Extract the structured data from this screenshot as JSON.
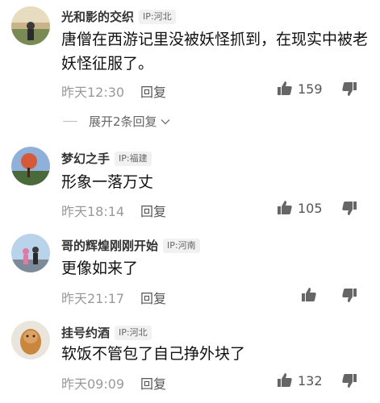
{
  "comments": [
    {
      "username": "光和影的交织",
      "ip": "IP:河北",
      "text": "唐僧在西游记里没被妖怪抓到，在现实中被老妖怪征服了。",
      "time": "昨天12:30",
      "reply_label": "回复",
      "likes": "159"
    },
    {
      "username": "梦幻之手",
      "ip": "IP:福建",
      "text": "形象一落万丈",
      "time": "昨天18:14",
      "reply_label": "回复",
      "likes": "105"
    },
    {
      "username": "哥的辉煌刚刚开始",
      "ip": "IP:河南",
      "text": "更像如来了",
      "time": "昨天21:17",
      "reply_label": "回复",
      "likes": ""
    },
    {
      "username": "挂号约酒",
      "ip": "IP:河北",
      "text": "软饭不管包了自己挣外块了",
      "time": "昨天09:09",
      "reply_label": "回复",
      "likes": "132"
    }
  ],
  "expand_replies": "展开2条回复",
  "icons": {
    "like": "thumbs-up-icon",
    "dislike": "thumbs-down-icon",
    "expand": "chevron-down-icon"
  },
  "colors": {
    "like": "#666666",
    "meta": "#999999",
    "ip_bg": "#f1f1f1"
  }
}
